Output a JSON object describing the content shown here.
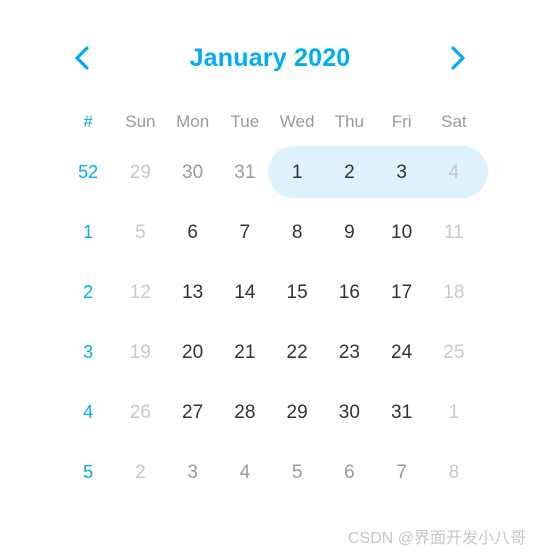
{
  "header": {
    "title": "January 2020",
    "prev_icon": "chevron-left-icon",
    "prev_label": "‹",
    "next_icon": "chevron-right-icon",
    "next_label": "›",
    "accent_color": "#00ACF5"
  },
  "weekdays": {
    "week_symbol": "#",
    "names": [
      "Sun",
      "Mon",
      "Tue",
      "Wed",
      "Thu",
      "Fri",
      "Sat"
    ]
  },
  "selection": {
    "highlight_color": "#ddf2fc",
    "start_day": "1",
    "end_day": "4",
    "start_column": "Wed",
    "end_column": "Sat"
  },
  "colors": {
    "accent": "#00ACF5",
    "day_text": "#333333",
    "muted_text": "#c9c9c9",
    "mid_muted_text": "#9a9a9a",
    "header_text": "#9a9a9a",
    "watermark": "#c6c6c6"
  },
  "weeks": [
    {
      "number": "52",
      "selected": true,
      "days": [
        {
          "label": "29",
          "state": "muted"
        },
        {
          "label": "30",
          "state": "mid"
        },
        {
          "label": "31",
          "state": "mid"
        },
        {
          "label": "1",
          "state": "normal"
        },
        {
          "label": "2",
          "state": "normal"
        },
        {
          "label": "3",
          "state": "normal"
        },
        {
          "label": "4",
          "state": "muted"
        }
      ]
    },
    {
      "number": "1",
      "selected": false,
      "days": [
        {
          "label": "5",
          "state": "muted"
        },
        {
          "label": "6",
          "state": "normal"
        },
        {
          "label": "7",
          "state": "normal"
        },
        {
          "label": "8",
          "state": "normal"
        },
        {
          "label": "9",
          "state": "normal"
        },
        {
          "label": "10",
          "state": "normal"
        },
        {
          "label": "11",
          "state": "muted"
        }
      ]
    },
    {
      "number": "2",
      "selected": false,
      "days": [
        {
          "label": "12",
          "state": "muted"
        },
        {
          "label": "13",
          "state": "normal"
        },
        {
          "label": "14",
          "state": "normal"
        },
        {
          "label": "15",
          "state": "normal"
        },
        {
          "label": "16",
          "state": "normal"
        },
        {
          "label": "17",
          "state": "normal"
        },
        {
          "label": "18",
          "state": "muted"
        }
      ]
    },
    {
      "number": "3",
      "selected": false,
      "days": [
        {
          "label": "19",
          "state": "muted"
        },
        {
          "label": "20",
          "state": "normal"
        },
        {
          "label": "21",
          "state": "normal"
        },
        {
          "label": "22",
          "state": "normal"
        },
        {
          "label": "23",
          "state": "normal"
        },
        {
          "label": "24",
          "state": "normal"
        },
        {
          "label": "25",
          "state": "muted"
        }
      ]
    },
    {
      "number": "4",
      "selected": false,
      "days": [
        {
          "label": "26",
          "state": "muted"
        },
        {
          "label": "27",
          "state": "normal"
        },
        {
          "label": "28",
          "state": "normal"
        },
        {
          "label": "29",
          "state": "normal"
        },
        {
          "label": "30",
          "state": "normal"
        },
        {
          "label": "31",
          "state": "normal"
        },
        {
          "label": "1",
          "state": "muted"
        }
      ]
    },
    {
      "number": "5",
      "selected": false,
      "days": [
        {
          "label": "2",
          "state": "muted"
        },
        {
          "label": "3",
          "state": "mid"
        },
        {
          "label": "4",
          "state": "mid"
        },
        {
          "label": "5",
          "state": "mid"
        },
        {
          "label": "6",
          "state": "mid"
        },
        {
          "label": "7",
          "state": "mid"
        },
        {
          "label": "8",
          "state": "muted"
        }
      ]
    }
  ],
  "watermark": {
    "text": "CSDN @界面开发小八哥"
  }
}
